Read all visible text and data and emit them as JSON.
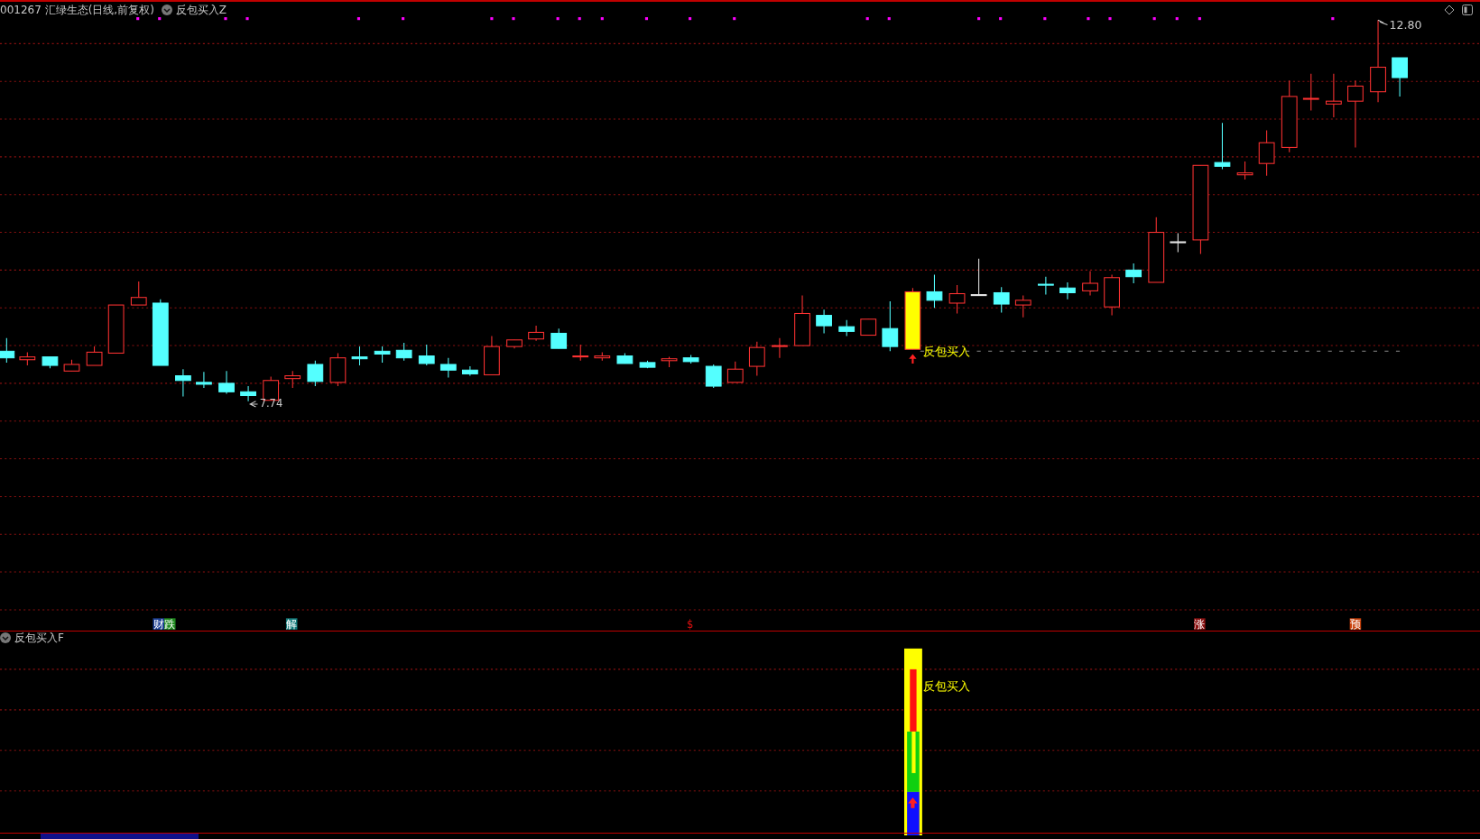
{
  "header": {
    "symbol": "001267",
    "name": "汇绿生态(日线,前复权)",
    "indicator": "反包买入Z"
  },
  "main_chart": {
    "low_label": "7.74",
    "high_label": "12.80",
    "signal_label": "反包买入",
    "event_tags": [
      {
        "text": "财",
        "kind": "box",
        "color": "#1c3f94"
      },
      {
        "text": "跌",
        "kind": "box",
        "color": "#1f8a1f"
      },
      {
        "text": "解",
        "kind": "box",
        "color": "#127a7a"
      },
      {
        "text": "$",
        "kind": "plain",
        "color": "#e01010"
      },
      {
        "text": "涨",
        "kind": "box",
        "color": "#8a1010"
      },
      {
        "text": "预",
        "kind": "box",
        "color": "#c8400a"
      }
    ]
  },
  "sub_panel": {
    "indicator": "反包买入F",
    "signal_label": "反包买入"
  }
}
